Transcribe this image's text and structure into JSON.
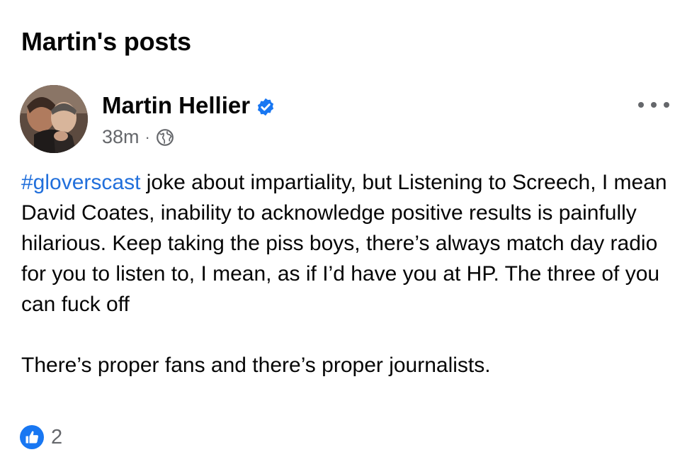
{
  "section": {
    "title": "Martin's posts"
  },
  "post": {
    "author": {
      "name": "Martin Hellier",
      "verified_icon": "verified-badge-icon",
      "avatar_icon": "avatar-photo"
    },
    "meta": {
      "time": "38m",
      "separator": "·",
      "audience_icon": "globe-icon"
    },
    "more_icon": "more-options-icon",
    "body": {
      "hashtag": "#gloverscast",
      "text_after_hashtag": " joke about impartiality, but Listening to Screech, I mean David Coates, inability to acknowledge positive results is painfully hilarious. Keep taking the piss boys, there’s always match day radio for you to listen to, I mean, as if I’d have you at HP.  The three of you can fuck off",
      "second_paragraph": "There’s proper fans and there’s proper journalists."
    },
    "reactions": {
      "icon": "like-icon",
      "count": "2"
    }
  },
  "colors": {
    "accent": "#216fdb",
    "verified": "#1877f2",
    "meta_text": "#65676b",
    "like": "#1877f2"
  }
}
